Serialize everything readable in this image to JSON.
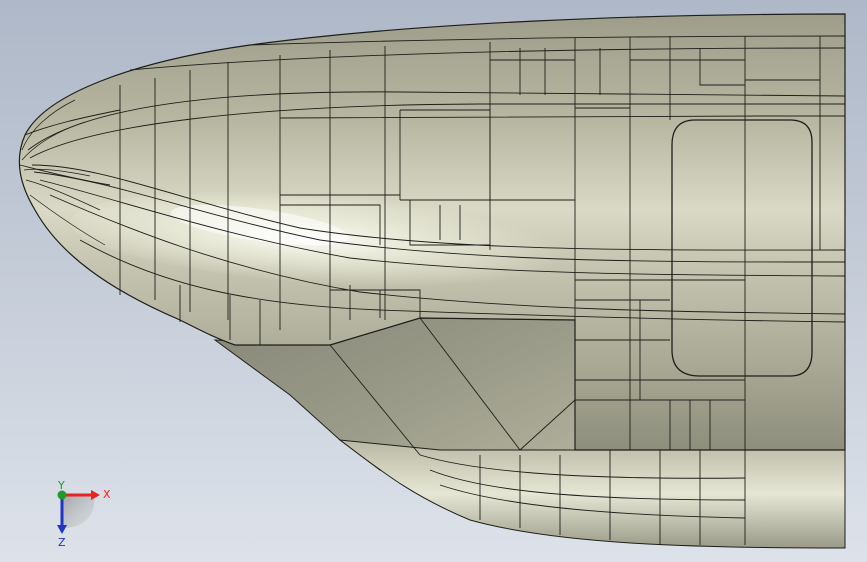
{
  "viewport": {
    "background_top": "#aeb8c8",
    "background_bottom": "#dde2ea",
    "model_fill": "#b3b39f",
    "model_highlight": "#f7f7ea",
    "edge_color": "#1e1e1a"
  },
  "triad": {
    "x_label": "X",
    "y_label": "Y",
    "z_label": "Z",
    "x_color": "#e8231e",
    "y_color": "#1f9a2b",
    "z_color": "#2134c8"
  }
}
